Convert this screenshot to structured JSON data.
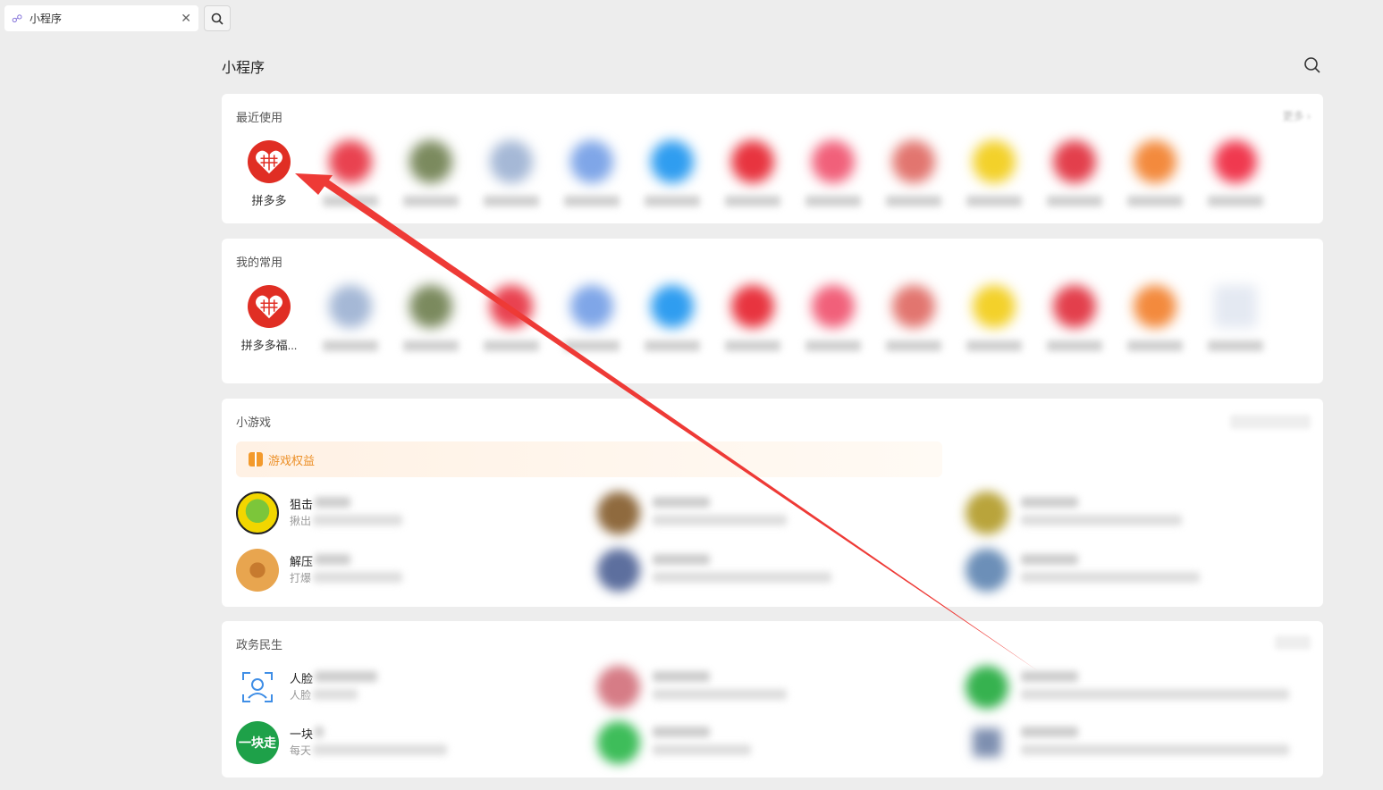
{
  "tab": {
    "icon": "miniprogram-link-icon",
    "label": "小程序",
    "close": "✕"
  },
  "page": {
    "title": "小程序"
  },
  "recent": {
    "title": "最近使用",
    "more": "更多",
    "first_app": {
      "label": "拼多多"
    }
  },
  "favorites": {
    "title": "我的常用",
    "first_app": {
      "label": "拼多多福..."
    }
  },
  "games": {
    "title": "小游戏",
    "promo": "游戏权益",
    "items": [
      {
        "title": "狙击",
        "sub": "揪出"
      },
      {
        "title": "解压",
        "sub": "打爆"
      }
    ]
  },
  "gov": {
    "title": "政务民生",
    "items": [
      {
        "title": "人脸",
        "sub": "人脸"
      },
      {
        "title": "一块",
        "sub": "每天",
        "icon_text": "一块走"
      }
    ]
  },
  "colors": {
    "pinduoduo": "#e02e24",
    "annotation_arrow": "#ee3a36",
    "promo_text": "#ec9028",
    "yikuaizou": "#1ea149"
  }
}
